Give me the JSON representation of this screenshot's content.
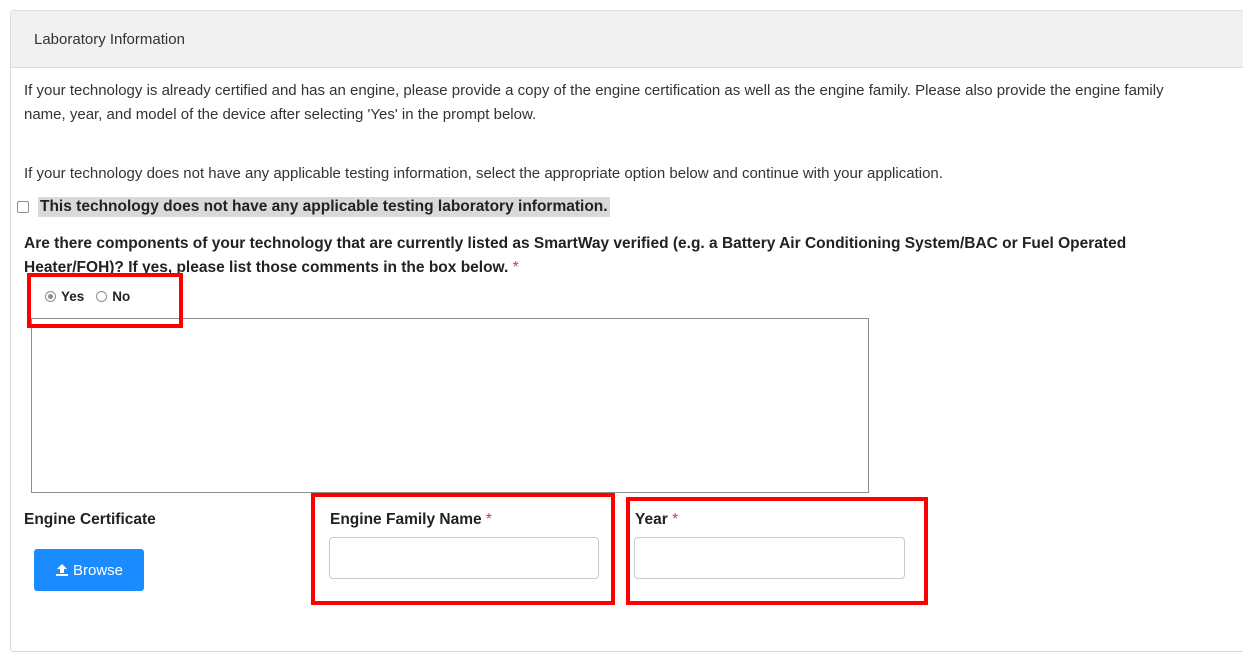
{
  "panel": {
    "title": "Laboratory Information",
    "paragraph1": "If your technology is already certified and has an engine, please provide a copy of the engine certification as well as the engine family. Please also provide the engine family name, year, and model of the device after selecting 'Yes' in the prompt below.",
    "paragraph2": "If your technology does not have any applicable testing information, select the appropriate option below and continue with your application."
  },
  "no_lab_checkbox": {
    "label": "This technology does not have any applicable testing laboratory information.",
    "checked": false
  },
  "components_question": {
    "text": "Are there components of your technology that are currently listed as SmartWay verified (e.g. a Battery Air Conditioning System/BAC or Fuel Operated Heater/FOH)? If yes, please list those comments in the box below.",
    "required_mark": "*",
    "options": [
      "Yes",
      "No"
    ],
    "selected": "Yes"
  },
  "comments_textarea": {
    "value": ""
  },
  "engine_certificate": {
    "label": "Engine Certificate",
    "browse_label": "Browse",
    "button_icon": "upload-icon"
  },
  "engine_family_name": {
    "label": "Engine Family Name",
    "required_mark": "*",
    "value": ""
  },
  "year": {
    "label": "Year",
    "required_mark": "*",
    "value": ""
  },
  "colors": {
    "primary_button": "#1a8cff",
    "highlight": "#ff0000",
    "required": "#dc3545"
  }
}
